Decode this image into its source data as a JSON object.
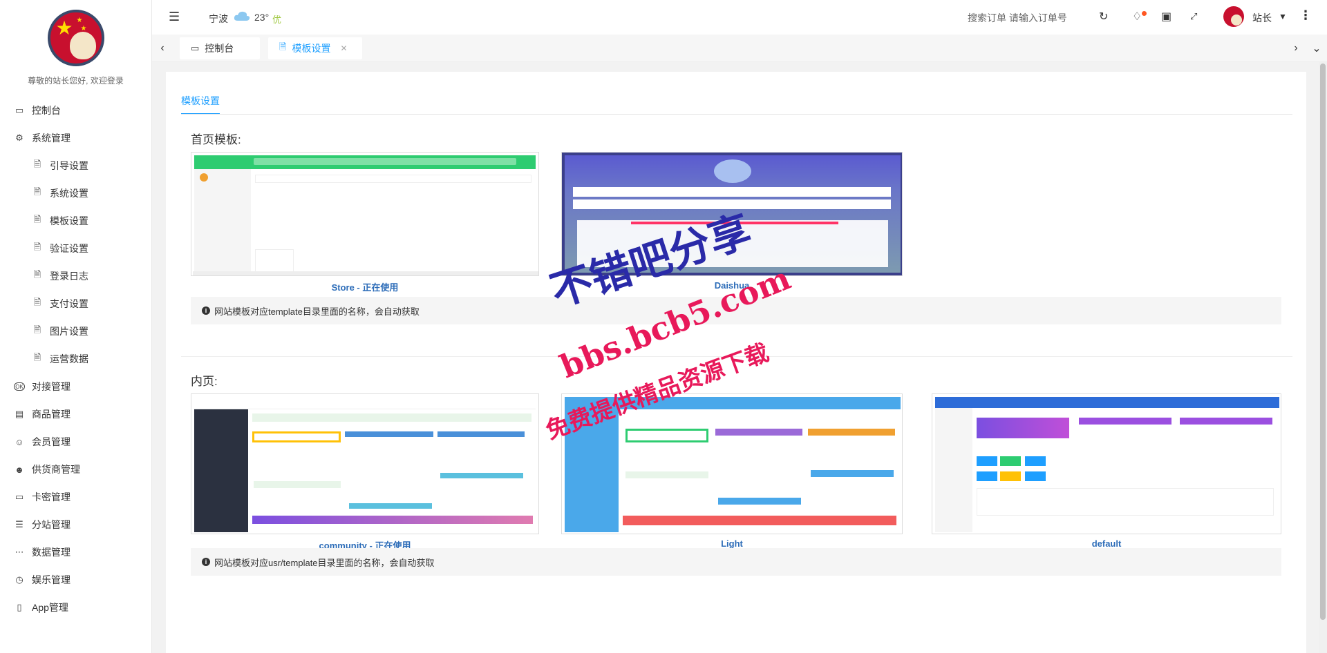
{
  "sidebar": {
    "welcome": "尊敬的站长您好, 欢迎登录",
    "items": [
      {
        "label": "控制台",
        "icon": "monitor-icon",
        "sub": false
      },
      {
        "label": "系统管理",
        "icon": "gear-icon",
        "sub": false
      },
      {
        "label": "引导设置",
        "icon": "file-icon",
        "sub": true
      },
      {
        "label": "系统设置",
        "icon": "file-icon",
        "sub": true
      },
      {
        "label": "模板设置",
        "icon": "file-icon",
        "sub": true
      },
      {
        "label": "验证设置",
        "icon": "file-icon",
        "sub": true
      },
      {
        "label": "登录日志",
        "icon": "file-icon",
        "sub": true
      },
      {
        "label": "支付设置",
        "icon": "file-icon",
        "sub": true
      },
      {
        "label": "图片设置",
        "icon": "file-icon",
        "sub": true
      },
      {
        "label": "运营数据",
        "icon": "file-icon",
        "sub": true
      },
      {
        "label": "对接管理",
        "icon": "ok-badge-icon",
        "sub": false
      },
      {
        "label": "商品管理",
        "icon": "database-icon",
        "sub": false
      },
      {
        "label": "会员管理",
        "icon": "user-icon",
        "sub": false
      },
      {
        "label": "供货商管理",
        "icon": "users-icon",
        "sub": false
      },
      {
        "label": "卡密管理",
        "icon": "folder-icon",
        "sub": false
      },
      {
        "label": "分站管理",
        "icon": "list-icon",
        "sub": false
      },
      {
        "label": "数据管理",
        "icon": "dots-icon",
        "sub": false
      },
      {
        "label": "娱乐管理",
        "icon": "dashboard-icon",
        "sub": false
      },
      {
        "label": "App管理",
        "icon": "phone-icon",
        "sub": false
      }
    ]
  },
  "topbar": {
    "city": "宁波",
    "temperature": "23°",
    "aqi": "优",
    "search_order": "搜索订单 请输入订单号",
    "user_name": "站长"
  },
  "tabs": [
    {
      "label": "控制台",
      "icon": "monitor-icon"
    },
    {
      "label": "模板设置",
      "icon": "file-icon"
    }
  ],
  "main": {
    "content_tab": "模板设置",
    "home_section_title": "首页模板:",
    "home_templates": [
      {
        "label": "Store - 正在使用"
      },
      {
        "label": "Daishua"
      }
    ],
    "home_note": "网站模板对应template目录里面的名称，会自动获取",
    "inner_section_title": "内页:",
    "inner_templates": [
      {
        "label": "community - 正在使用"
      },
      {
        "label": "Light"
      },
      {
        "label": "default"
      }
    ],
    "inner_note": "网站模板对应usr/template目录里面的名称，会自动获取"
  },
  "watermark": {
    "line1": "不错吧分享",
    "line2": "bbs.bcb5.com",
    "line3": "免费提供精品资源下载"
  },
  "colors": {
    "accent": "#1e9fff",
    "store_green": "#2ecc71",
    "watermark_blue": "#2a2aa8",
    "watermark_red": "#e8195a"
  }
}
